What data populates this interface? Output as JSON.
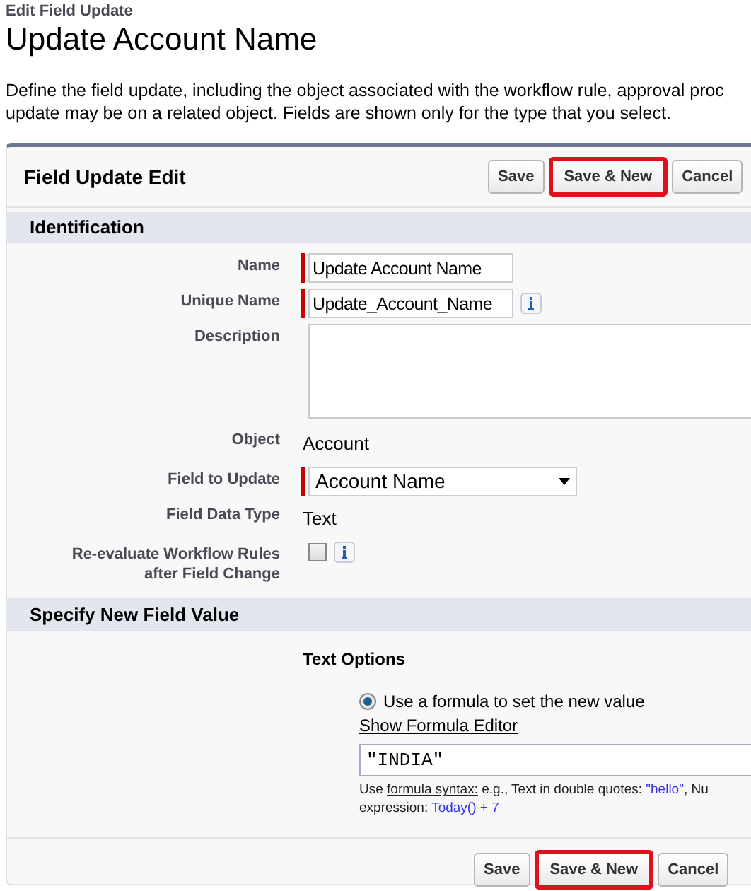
{
  "breadcrumb": "Edit Field Update",
  "title": "Update Account Name",
  "intro": [
    "Define the field update, including the object associated with the workflow rule, approval proc",
    "update may be on a related object. Fields are shown only for the type that you select."
  ],
  "panel": {
    "title": "Field Update Edit",
    "top_buttons": [
      {
        "label": "Save",
        "highlighted": false
      },
      {
        "label": "Save & New",
        "highlighted": true
      },
      {
        "label": "Cancel",
        "highlighted": false
      }
    ],
    "sections": [
      {
        "title": "Identification",
        "fields": [
          {
            "kind": "input",
            "label": "Name",
            "value": "Update Account Name",
            "required": true
          },
          {
            "kind": "input",
            "label": "Unique Name",
            "value": "Update_Account_Name",
            "required": true,
            "info": true
          },
          {
            "kind": "textarea",
            "label": "Description"
          },
          {
            "kind": "static",
            "label": "Object",
            "value": "Account"
          },
          {
            "kind": "select",
            "label": "Field to Update",
            "value": "Account Name",
            "required": true
          },
          {
            "kind": "static",
            "label": "Field Data Type",
            "value": "Text"
          },
          {
            "kind": "checkbox",
            "label": "Re-evaluate Workflow Rules after Field Change",
            "checked": false,
            "info": true
          }
        ]
      },
      {
        "title": "Specify New Field Value",
        "options_title": "Text Options",
        "radio": {
          "label": "Use a formula to set the new value",
          "selected": true
        },
        "editor_link": "Show Formula Editor",
        "formula": "\"INDIA\"",
        "help": [
          [
            {
              "kind": "text",
              "text": "Use "
            },
            {
              "kind": "link",
              "text": "formula syntax:"
            },
            {
              "kind": "text",
              "text": " e.g., Text in double quotes: "
            },
            {
              "kind": "code",
              "text": "\"hello\""
            },
            {
              "kind": "text",
              "text": ", Nu"
            }
          ],
          [
            {
              "kind": "text",
              "text": "expression: "
            },
            {
              "kind": "code",
              "text": "Today() + 7"
            }
          ]
        ]
      }
    ],
    "bottom_buttons": [
      {
        "label": "Save",
        "highlighted": false
      },
      {
        "label": "Save & New",
        "highlighted": true
      },
      {
        "label": "Cancel",
        "highlighted": false
      }
    ]
  }
}
